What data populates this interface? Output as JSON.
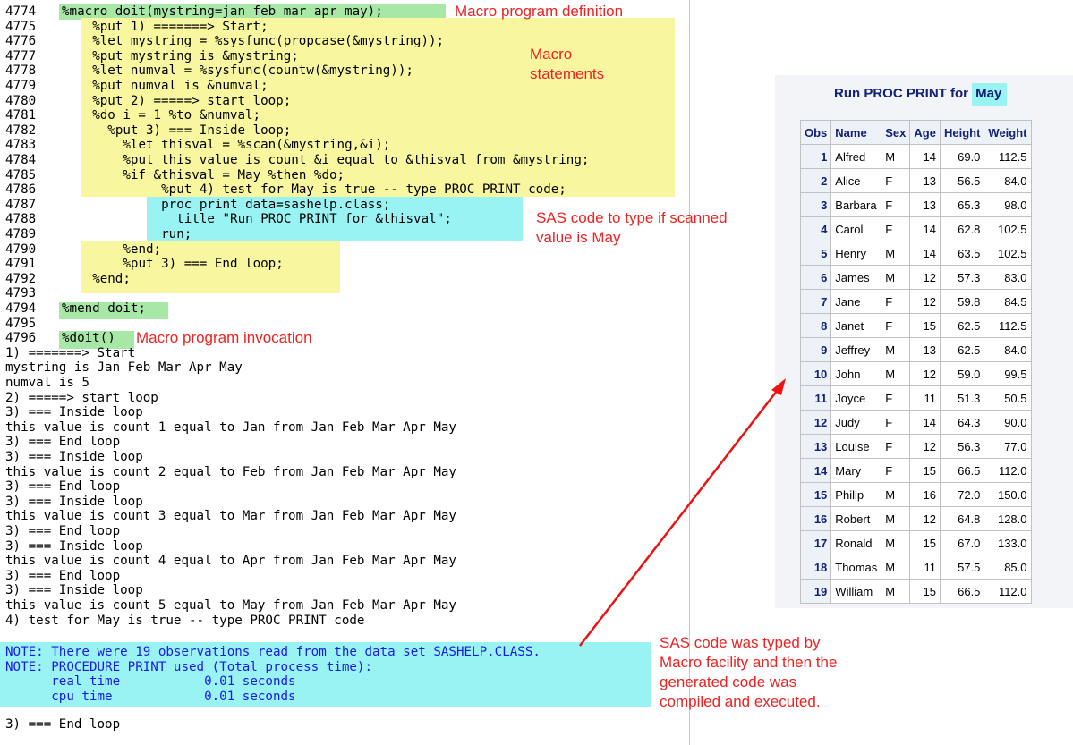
{
  "log": {
    "source_lines": [
      {
        "num": "4774",
        "code": "%macro doit(mystring=jan feb mar apr may);",
        "indent": 0
      },
      {
        "num": "4775",
        "code": "%put 1) =======> Start;",
        "indent": 4
      },
      {
        "num": "4776",
        "code": "%let mystring = %sysfunc(propcase(&mystring));",
        "indent": 4
      },
      {
        "num": "4777",
        "code": "%put mystring is &mystring;",
        "indent": 4
      },
      {
        "num": "4778",
        "code": "%let numval = %sysfunc(countw(&mystring));",
        "indent": 4
      },
      {
        "num": "4779",
        "code": "%put numval is &numval;",
        "indent": 4
      },
      {
        "num": "4780",
        "code": "%put 2) =====> start loop;",
        "indent": 4
      },
      {
        "num": "4781",
        "code": "%do i = 1 %to &numval;",
        "indent": 4
      },
      {
        "num": "4782",
        "code": "%put 3) === Inside loop;",
        "indent": 6
      },
      {
        "num": "4783",
        "code": "%let thisval = %scan(&mystring,&i);",
        "indent": 8
      },
      {
        "num": "4784",
        "code": "%put this value is count &i equal to &thisval from &mystring;",
        "indent": 8
      },
      {
        "num": "4785",
        "code": "%if &thisval = May %then %do;",
        "indent": 8
      },
      {
        "num": "4786",
        "code": "%put 4) test for May is true -- type PROC PRINT code;",
        "indent": 13
      },
      {
        "num": "4787",
        "code": "proc print data=sashelp.class;",
        "indent": 13
      },
      {
        "num": "4788",
        "code": "title \"Run PROC PRINT for &thisval\";",
        "indent": 15
      },
      {
        "num": "4789",
        "code": "run;",
        "indent": 13
      },
      {
        "num": "4790",
        "code": "%end;",
        "indent": 8
      },
      {
        "num": "4791",
        "code": "%put 3) === End loop;",
        "indent": 8
      },
      {
        "num": "4792",
        "code": "%end;",
        "indent": 4
      },
      {
        "num": "4793",
        "code": "",
        "indent": 0
      },
      {
        "num": "4794",
        "code": "%mend doit;",
        "indent": 0
      },
      {
        "num": "4795",
        "code": "",
        "indent": 0
      },
      {
        "num": "4796",
        "code": "%doit()",
        "indent": 0
      }
    ],
    "output_lines": [
      "1) =======> Start",
      "mystring is Jan Feb Mar Apr May",
      "numval is 5",
      "2) =====> start loop",
      "3) === Inside loop",
      "this value is count 1 equal to Jan from Jan Feb Mar Apr May",
      "3) === End loop",
      "3) === Inside loop",
      "this value is count 2 equal to Feb from Jan Feb Mar Apr May",
      "3) === End loop",
      "3) === Inside loop",
      "this value is count 3 equal to Mar from Jan Feb Mar Apr May",
      "3) === End loop",
      "3) === Inside loop",
      "this value is count 4 equal to Apr from Jan Feb Mar Apr May",
      "3) === End loop",
      "3) === Inside loop",
      "this value is count 5 equal to May from Jan Feb Mar Apr May",
      "4) test for May is true -- type PROC PRINT code"
    ],
    "note_lines": [
      "NOTE: There were 19 observations read from the data set SASHELP.CLASS.",
      "NOTE: PROCEDURE PRINT used (Total process time):",
      "      real time           0.01 seconds",
      "      cpu time            0.01 seconds"
    ],
    "final_line": "3) === End loop"
  },
  "annotations": {
    "macro_def": "Macro program definition",
    "macro_statements": [
      "Macro",
      "statements"
    ],
    "sas_code": [
      "SAS code to type if scanned",
      "value is May"
    ],
    "invocation": "Macro program invocation",
    "typed": [
      "SAS code was typed by",
      "Macro facility and then the",
      "generated code was",
      "compiled and executed."
    ]
  },
  "report": {
    "title_prefix": "Run PROC PRINT for ",
    "title_value": "May",
    "columns": [
      "Obs",
      "Name",
      "Sex",
      "Age",
      "Height",
      "Weight"
    ],
    "rows": [
      [
        "1",
        "Alfred",
        "M",
        "14",
        "69.0",
        "112.5"
      ],
      [
        "2",
        "Alice",
        "F",
        "13",
        "56.5",
        "84.0"
      ],
      [
        "3",
        "Barbara",
        "F",
        "13",
        "65.3",
        "98.0"
      ],
      [
        "4",
        "Carol",
        "F",
        "14",
        "62.8",
        "102.5"
      ],
      [
        "5",
        "Henry",
        "M",
        "14",
        "63.5",
        "102.5"
      ],
      [
        "6",
        "James",
        "M",
        "12",
        "57.3",
        "83.0"
      ],
      [
        "7",
        "Jane",
        "F",
        "12",
        "59.8",
        "84.5"
      ],
      [
        "8",
        "Janet",
        "F",
        "15",
        "62.5",
        "112.5"
      ],
      [
        "9",
        "Jeffrey",
        "M",
        "13",
        "62.5",
        "84.0"
      ],
      [
        "10",
        "John",
        "M",
        "12",
        "59.0",
        "99.5"
      ],
      [
        "11",
        "Joyce",
        "F",
        "11",
        "51.3",
        "50.5"
      ],
      [
        "12",
        "Judy",
        "F",
        "14",
        "64.3",
        "90.0"
      ],
      [
        "13",
        "Louise",
        "F",
        "12",
        "56.3",
        "77.0"
      ],
      [
        "14",
        "Mary",
        "F",
        "15",
        "66.5",
        "112.0"
      ],
      [
        "15",
        "Philip",
        "M",
        "16",
        "72.0",
        "150.0"
      ],
      [
        "16",
        "Robert",
        "M",
        "12",
        "64.8",
        "128.0"
      ],
      [
        "17",
        "Ronald",
        "M",
        "15",
        "67.0",
        "133.0"
      ],
      [
        "18",
        "Thomas",
        "M",
        "11",
        "57.5",
        "85.0"
      ],
      [
        "19",
        "William",
        "M",
        "15",
        "66.5",
        "112.0"
      ]
    ]
  },
  "colors": {
    "annotation": "#ee2222",
    "note_text": "#1a1ae6",
    "macro_def_highlight": "#a7e8a7",
    "macro_body_highlight": "#f8f7a0",
    "generated_code_highlight": "#99f3f3",
    "report_header": "#112277"
  }
}
